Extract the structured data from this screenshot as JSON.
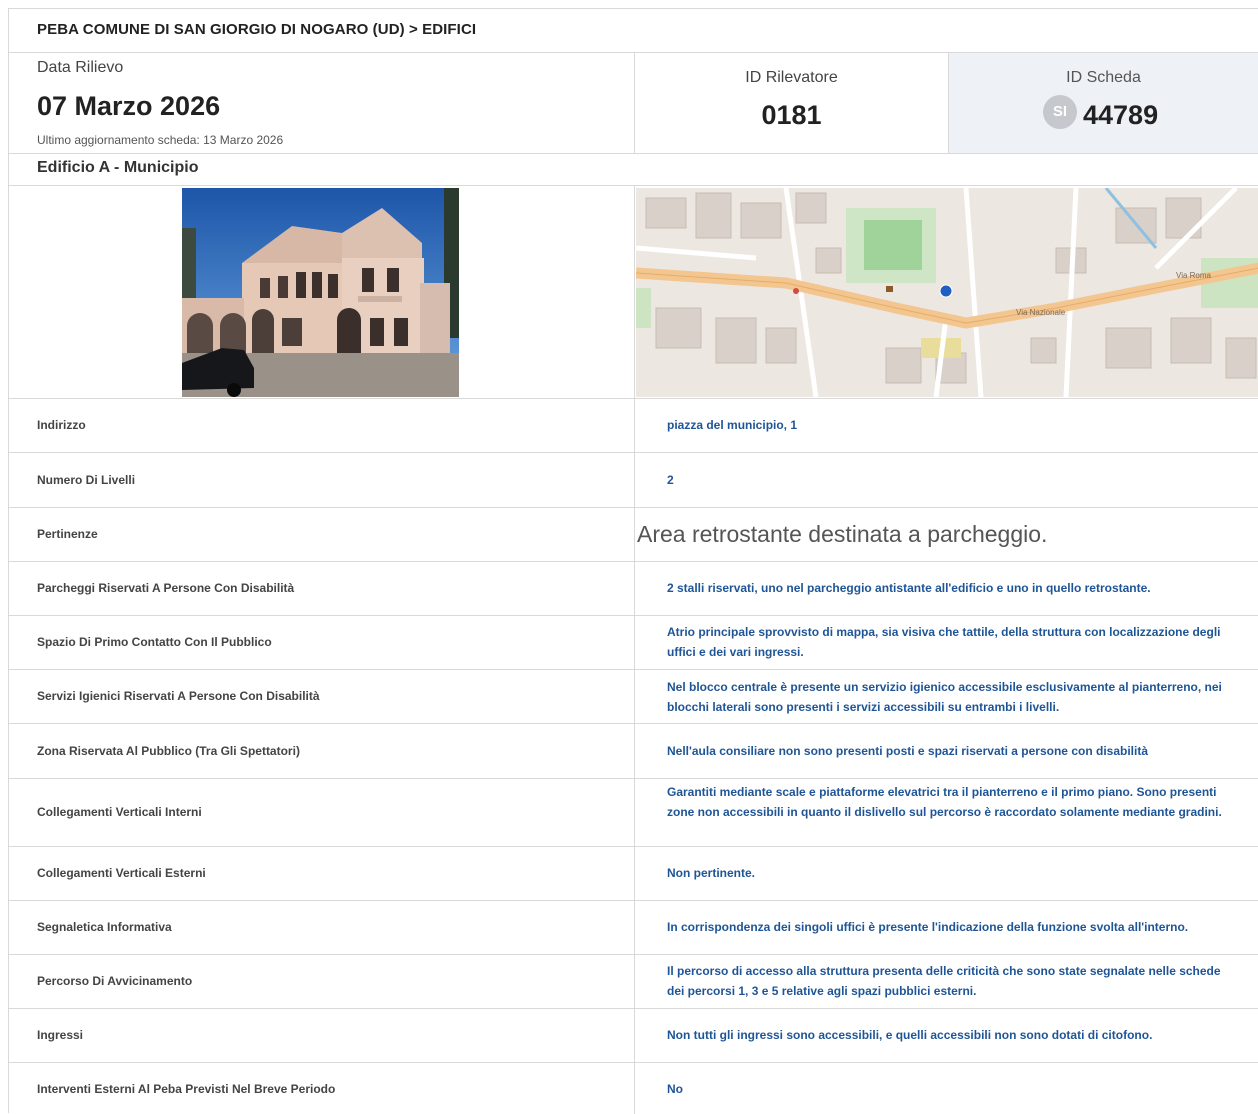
{
  "header": {
    "title": "PEBA COMUNE DI SAN GIORGIO DI NOGARO (UD) > EDIFICI"
  },
  "survey": {
    "date_label": "Data Rilievo",
    "date_value": "07 Marzo 2026",
    "last_update": "Ultimo aggiornamento scheda: 13 Marzo 2026",
    "surveyor_label": "ID Rilevatore",
    "surveyor_value": "0181",
    "card_label": "ID Scheda",
    "card_badge": "SI",
    "card_value": "44789"
  },
  "building": {
    "name": "Edificio A - Municipio"
  },
  "map": {
    "labels": [
      "Via Roma",
      "Via Nazionale"
    ]
  },
  "rows": [
    {
      "label": "Indirizzo",
      "value": "piazza del municipio, 1"
    },
    {
      "label": "Numero Di Livelli",
      "value": "2"
    },
    {
      "label": "Pertinenze",
      "value": "Area retrostante destinata a parcheggio."
    },
    {
      "label": "Parcheggi Riservati A Persone Con Disabilità",
      "value": "2 stalli riservati, uno nel parcheggio antistante all'edificio e uno in quello retrostante."
    },
    {
      "label": "Spazio Di Primo Contatto Con Il Pubblico",
      "value": "Atrio principale sprovvisto di mappa, sia visiva che tattile, della struttura con localizzazione degli uffici e dei vari ingressi."
    },
    {
      "label": "Servizi Igienici Riservati A Persone Con Disabilità",
      "value": "Nel blocco centrale è presente un servizio igienico accessibile esclusivamente al pianterreno, nei blocchi laterali sono presenti i servizi accessibili su entrambi i livelli."
    },
    {
      "label": "Zona Riservata Al Pubblico (Tra Gli Spettatori)",
      "value": "Nell'aula consiliare non sono presenti posti e spazi riservati a persone con disabilità"
    },
    {
      "label": "Collegamenti Verticali Interni",
      "value": "Garantiti mediante scale e piattaforme elevatrici tra il pianterreno e il primo piano. Sono presenti zone non accessibili in quanto il dislivello sul percorso è raccordato solamente mediante gradini."
    },
    {
      "label": "Collegamenti Verticali Esterni",
      "value": "Non pertinente."
    },
    {
      "label": "Segnaletica Informativa",
      "value": "In corrispondenza dei singoli uffici è presente l'indicazione della funzione svolta all'interno."
    },
    {
      "label": "Percorso Di Avvicinamento",
      "value": "Il percorso di accesso alla struttura presenta delle criticità che sono state segnalate nelle schede dei percorsi 1, 3 e 5 relative agli spazi pubblici esterni."
    },
    {
      "label": "Ingressi",
      "value": "Non tutti gli ingressi sono accessibili, e quelli accessibili non sono dotati di citofono."
    },
    {
      "label": "Interventi Esterni Al Peba Previsti Nel Breve Periodo",
      "value": "No"
    }
  ]
}
